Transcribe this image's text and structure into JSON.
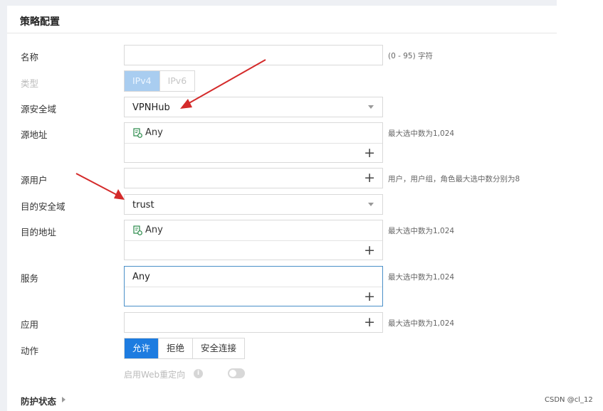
{
  "panel": {
    "title": "策略配置"
  },
  "fields": {
    "name": {
      "label": "名称",
      "value": "",
      "hint": "(0 - 95) 字符"
    },
    "type": {
      "label": "类型",
      "options": [
        "IPv4",
        "IPv6"
      ],
      "selected": "IPv4"
    },
    "src_zone": {
      "label": "源安全域",
      "value": "VPNHub"
    },
    "src_addr": {
      "label": "源地址",
      "value": "Any",
      "hint": "最大选中数为1,024"
    },
    "src_user": {
      "label": "源用户",
      "value": "",
      "hint": "用户，用户组，角色最大选中数分别为8"
    },
    "dst_zone": {
      "label": "目的安全域",
      "value": "trust"
    },
    "dst_addr": {
      "label": "目的地址",
      "value": "Any",
      "hint": "最大选中数为1,024"
    },
    "service": {
      "label": "服务",
      "value": "Any",
      "hint": "最大选中数为1,024"
    },
    "app": {
      "label": "应用",
      "value": "",
      "hint": "最大选中数为1,024"
    },
    "action": {
      "label": "动作",
      "options": [
        "允许",
        "拒绝",
        "安全连接"
      ],
      "selected": "允许"
    },
    "web_redirect": {
      "label": "启用Web重定向",
      "enabled": false
    }
  },
  "section": {
    "label": "防护状态"
  },
  "watermark": "CSDN @cl_12",
  "colors": {
    "accent": "#1d7ce0",
    "annotation_arrow": "#d42a2a"
  },
  "icons": {
    "add": "plus-icon",
    "dropdown": "caret-down-icon",
    "address": "address-object-icon",
    "info": "info-icon"
  }
}
